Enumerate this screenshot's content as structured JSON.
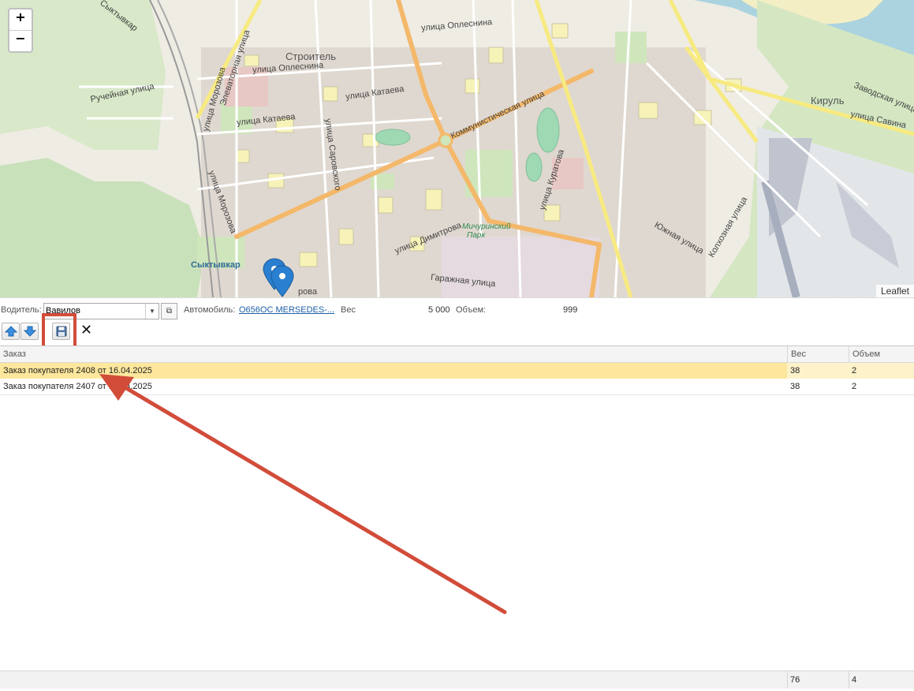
{
  "map": {
    "zoom_in": "+",
    "zoom_out": "−",
    "attribution": "Leaflet",
    "labels": {
      "stroitel": "Строитель",
      "kirul": "Кируль",
      "syktyvkar_district": "Сыктывкар",
      "syktyvkar_river": "Сыктывкар",
      "ul_oplesnina_1": "улица Оплеснина",
      "ul_oplesnina_2": "улица Оплеснина",
      "ul_kataeva_1": "улица Катаева",
      "ul_kataeva_2": "улица Катаева",
      "kommunisticheskaya": "Коммунистическая улица",
      "kuratova": "улица Куратова",
      "dimitrova": "улица Димитрова",
      "michurinsky": "Мичуринский",
      "park": "Парк",
      "garazhnaya": "Гаражная улица",
      "yuzhnaya": "Южная улица",
      "kolkhoznaya": "Колхозная улица",
      "ruchejnaya": "Ручейная улица",
      "morozova_1": "улица Морозова",
      "morozova_2": "улица Морозова",
      "elevatornaya": "Элеваторная улица",
      "sarovskogo": "улица Саровского",
      "zavodskaya": "Заводская улица",
      "savina": "улица Савина",
      "dimitrova_partial": "рова"
    },
    "marker_color": "#2a7fd0"
  },
  "form": {
    "driver_label": "Водитель:",
    "driver_value": "Вавилов",
    "car_label": "Автомобиль:",
    "car_value": "О656ОС MERSEDES-...",
    "weight_label": "Вес",
    "weight_value": "5 000",
    "volume_label": "Объем:",
    "volume_value": "999"
  },
  "table": {
    "columns": [
      "Заказ",
      "Вес",
      "Объем"
    ],
    "rows": [
      {
        "order": "Заказ покупателя 2408 от 16.04.2025",
        "weight": "38",
        "volume": "2",
        "selected": true
      },
      {
        "order": "Заказ покупателя 2407 от 15.04.2025",
        "weight": "38",
        "volume": "2",
        "selected": false
      }
    ],
    "footer": {
      "weight": "76",
      "volume": "4"
    }
  },
  "colors": {
    "accent_red": "#d24c3a",
    "selection": "#fde79c",
    "link": "#1d5fa6"
  }
}
